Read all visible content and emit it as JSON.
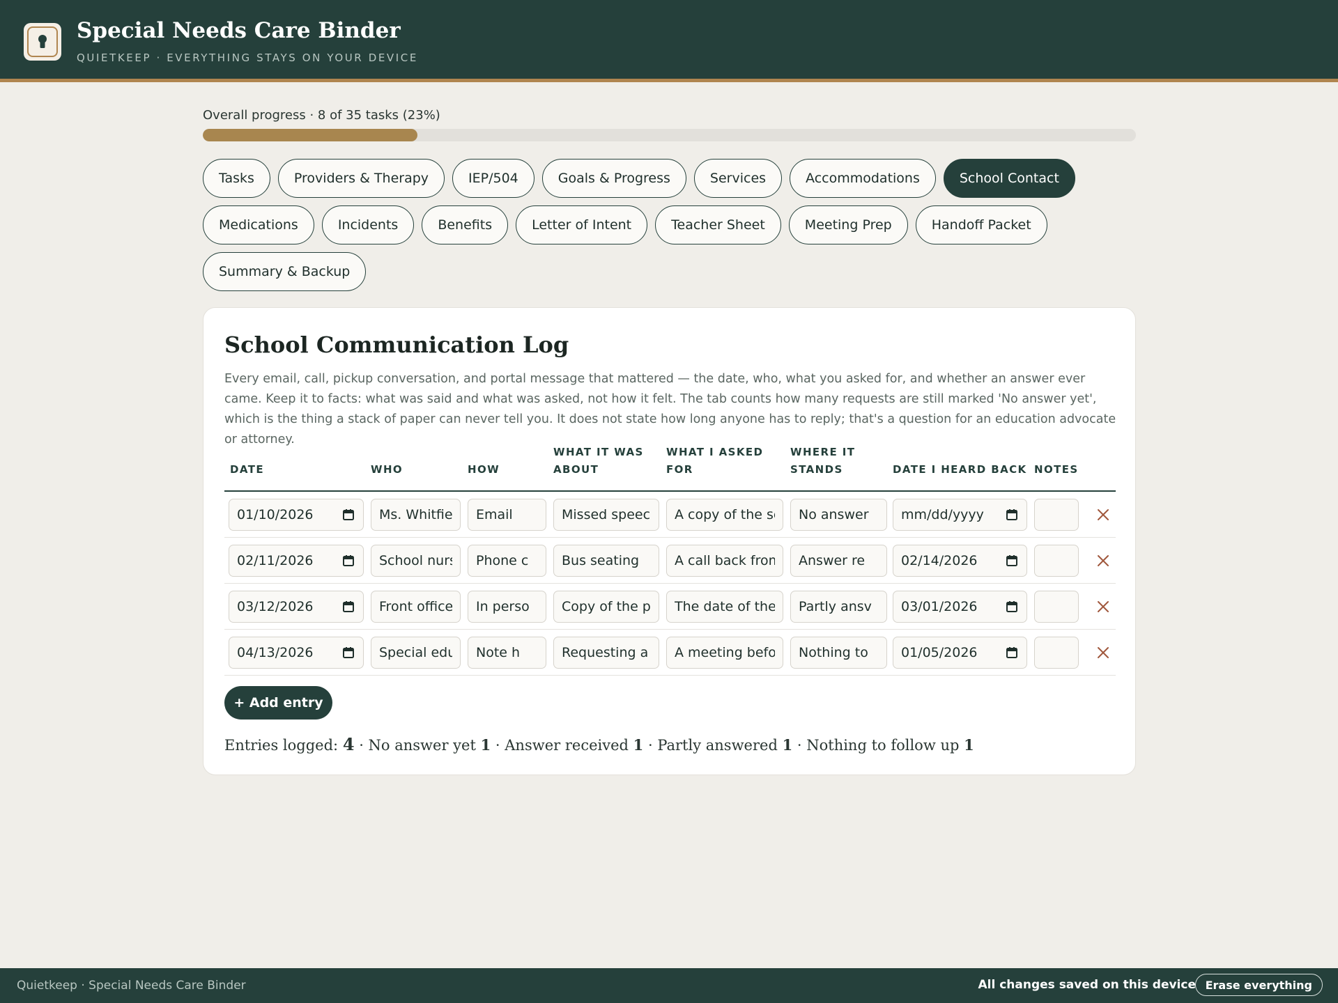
{
  "app": {
    "title": "Special Needs Care Binder",
    "subtitle": "QUIETKEEP · EVERYTHING STAYS ON YOUR DEVICE"
  },
  "progress": {
    "label": "Overall progress · 8 of 35 tasks (23%)",
    "fraction": 0.23
  },
  "tabs": [
    {
      "label": "Tasks",
      "active": false
    },
    {
      "label": "Providers & Therapy",
      "active": false
    },
    {
      "label": "IEP/504",
      "active": false
    },
    {
      "label": "Goals & Progress",
      "active": false
    },
    {
      "label": "Services",
      "active": false
    },
    {
      "label": "Accommodations",
      "active": false
    },
    {
      "label": "School Contact",
      "active": true
    },
    {
      "label": "Medications",
      "active": false
    },
    {
      "label": "Incidents",
      "active": false
    },
    {
      "label": "Benefits",
      "active": false
    },
    {
      "label": "Letter of Intent",
      "active": false
    },
    {
      "label": "Teacher Sheet",
      "active": false
    },
    {
      "label": "Meeting Prep",
      "active": false
    },
    {
      "label": "Handoff Packet",
      "active": false
    },
    {
      "label": "Summary & Backup",
      "active": false
    }
  ],
  "log": {
    "title": "School Communication Log",
    "description": "Every email, call, pickup conversation, and portal message that mattered — the date, who, what you asked for, and whether an answer ever came. Keep it to facts: what was said and what was asked, not how it felt. The tab counts how many requests are still marked 'No answer yet', which is the thing a stack of paper can never tell you. It does not state how long anyone has to reply; that's a question for an education advocate or attorney.",
    "columns": {
      "date": "DATE",
      "who": "WHO",
      "how": "HOW",
      "about": "WHAT IT WAS ABOUT",
      "asked": "WHAT I ASKED FOR",
      "stands": "WHERE IT STANDS",
      "heard": "DATE I HEARD BACK",
      "notes": "NOTES"
    },
    "rows": [
      {
        "date": "01/10/2026",
        "who": "Ms. Whitfield",
        "how": "Email",
        "about": "Missed speech",
        "asked": "A copy of the ser",
        "stands": "No answer",
        "heard": "mm/dd/yyyy",
        "notes": ""
      },
      {
        "date": "02/11/2026",
        "who": "School nurse",
        "how": "Phone c",
        "about": "Bus seating",
        "asked": "A call back from",
        "stands": "Answer re",
        "heard": "02/14/2026",
        "notes": ""
      },
      {
        "date": "03/12/2026",
        "who": "Front office",
        "how": "In perso",
        "about": "Copy of the pro",
        "asked": "The date of the r",
        "stands": "Partly ansv",
        "heard": "03/01/2026",
        "notes": ""
      },
      {
        "date": "04/13/2026",
        "who": "Special educ",
        "how": "Note h",
        "about": "Requesting a c",
        "asked": "A meeting before",
        "stands": "Nothing to",
        "heard": "01/05/2026",
        "notes": ""
      }
    ],
    "add_label": "+ Add entry",
    "summary": {
      "entries_label": "Entries logged:",
      "entries_count": "4",
      "no_answer_label": "No answer yet",
      "no_answer_count": "1",
      "answered_label": "Answer received",
      "answered_count": "1",
      "partly_label": "Partly answered",
      "partly_count": "1",
      "nothing_label": "Nothing to follow up",
      "nothing_count": "1"
    }
  },
  "footer": {
    "left": "Quietkeep · Special Needs Care Binder",
    "saved": "All changes saved on this device",
    "erase_label": "Erase everything"
  },
  "colors": {
    "primary": "#25403b",
    "accent": "#a8864f",
    "delete": "#a0573c"
  },
  "icons": [
    "keyhole-icon",
    "calendar-icon",
    "close-icon"
  ]
}
